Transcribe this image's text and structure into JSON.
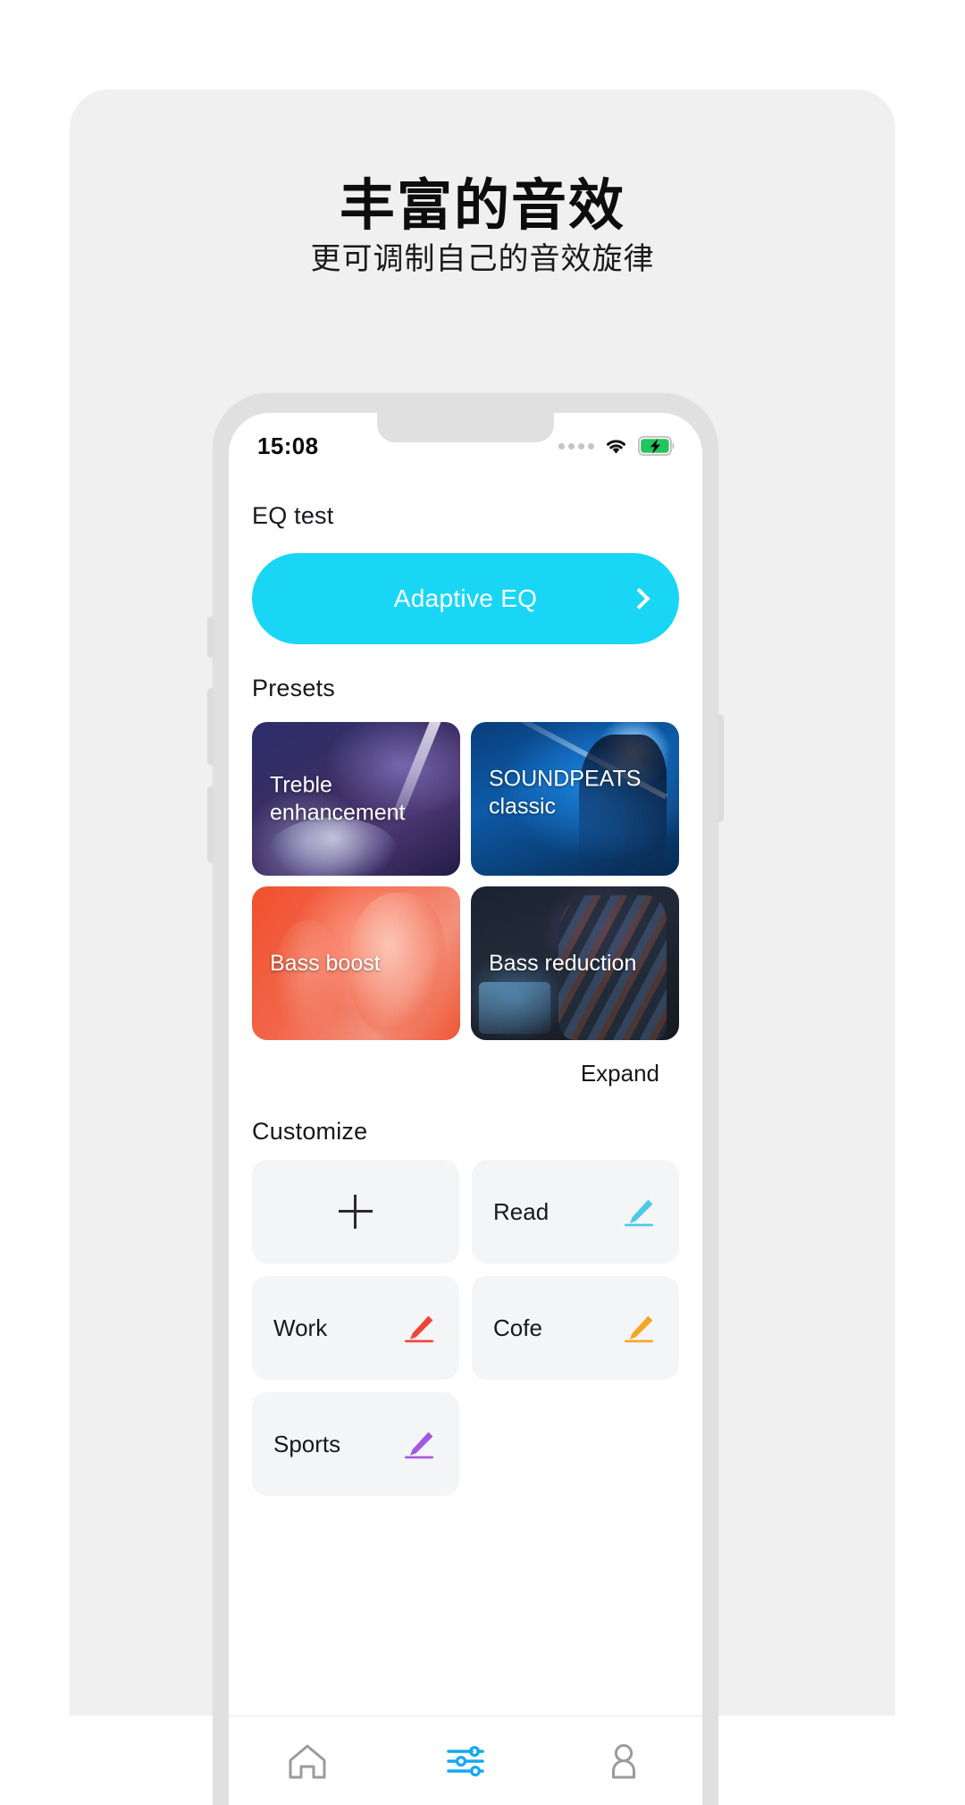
{
  "promo": {
    "title": "丰富的音效",
    "subtitle": "更可调制自己的音效旋律"
  },
  "status_bar": {
    "time": "15:08",
    "signal_icon": "signal-dots-icon",
    "wifi_icon": "wifi-icon",
    "battery_icon": "battery-charging-icon",
    "battery_color": "#22c55e"
  },
  "app": {
    "eq_test_label": "EQ test",
    "adaptive_eq": {
      "label": "Adaptive EQ",
      "chevron_icon": "chevron-right-icon",
      "color": "#1ad6f5"
    },
    "presets_label": "Presets",
    "presets": [
      {
        "label": "Treble enhancement",
        "art": "drummer-photo"
      },
      {
        "label": "SOUNDPEATS classic",
        "art": "violinist-photo"
      },
      {
        "label": "Bass boost",
        "art": "headphones-portrait-photo"
      },
      {
        "label": "Bass reduction",
        "art": "studio-engineers-photo"
      }
    ],
    "expand_label": "Expand",
    "customize_label": "Customize",
    "customize_tiles": [
      {
        "label": "",
        "icon": "plus-icon",
        "icon_color": "#2a2a2a"
      },
      {
        "label": "Read",
        "icon": "pencil-icon",
        "icon_color": "#4cc9e8"
      },
      {
        "label": "Work",
        "icon": "pencil-icon",
        "icon_color": "#f04438"
      },
      {
        "label": "Cofe",
        "icon": "pencil-icon",
        "icon_color": "#f5a623"
      },
      {
        "label": "Sports",
        "icon": "pencil-icon",
        "icon_color": "#a259e0"
      }
    ],
    "bottom_nav": [
      {
        "name": "home",
        "icon": "home-icon",
        "active": false,
        "color": "#9b9b9b"
      },
      {
        "name": "equalizer",
        "icon": "sliders-icon",
        "active": true,
        "color": "#14a8f0"
      },
      {
        "name": "profile",
        "icon": "person-icon",
        "active": false,
        "color": "#9b9b9b"
      }
    ]
  }
}
